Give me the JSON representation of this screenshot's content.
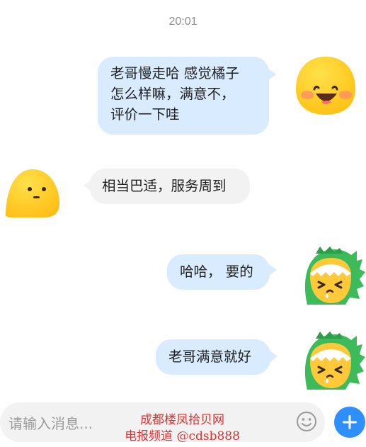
{
  "status": {
    "timestamp": "20:01"
  },
  "messages": [
    {
      "direction": "outgoing",
      "lines": [
        "老哥慢走哈 感觉橘子",
        "怎么样嘛，满意不，",
        "评价一下哇"
      ],
      "avatar_icon": "laughing-yellow-blob-icon"
    },
    {
      "direction": "incoming",
      "lines": [
        "相当巴适，服务周到"
      ],
      "avatar_icon": "yellow-blob-avatar-icon"
    },
    {
      "direction": "outgoing",
      "lines": [
        "哈哈， 要的"
      ],
      "avatar_icon": "dinosaur-costume-avatar-icon"
    },
    {
      "direction": "outgoing",
      "lines": [
        "老哥满意就好"
      ],
      "avatar_icon": "dinosaur-costume-avatar-icon"
    }
  ],
  "composer": {
    "placeholder": "请输入消息...",
    "emoji_icon": "emoji-icon",
    "send_icon": "plus-icon"
  },
  "watermark": {
    "line1": "成都楼凤拾贝网",
    "line2": "电报频道 @cdsb888"
  },
  "colors": {
    "outgoing_bubble": "#d9ecff",
    "incoming_bubble": "#f2f2f2",
    "accent": "#2f8fff",
    "watermark": "#e03030"
  }
}
